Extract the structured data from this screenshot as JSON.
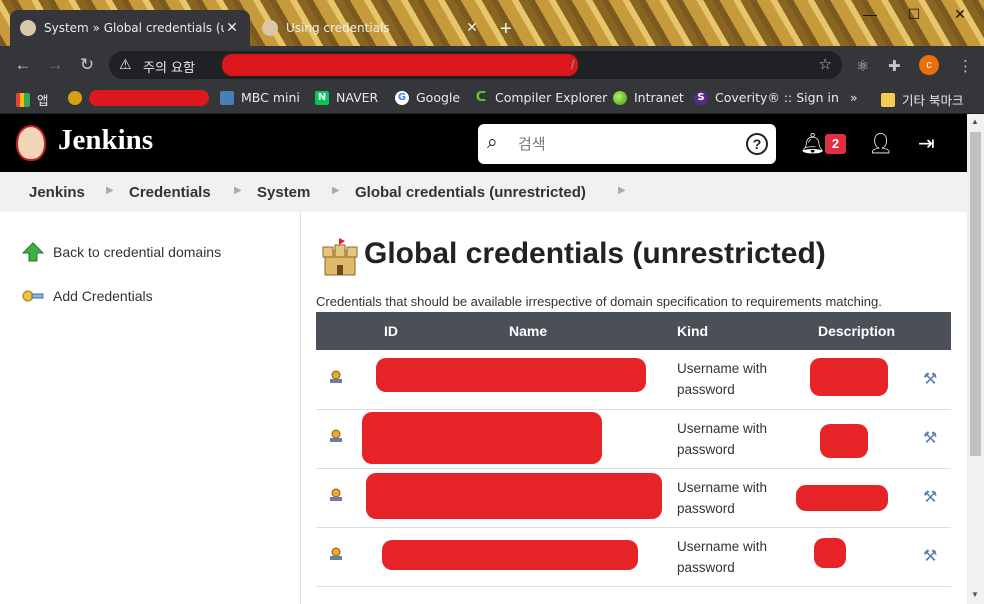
{
  "browser": {
    "tabs": [
      {
        "title": "System » Global credentials (un",
        "active": true
      },
      {
        "title": "Using credentials",
        "active": false
      }
    ],
    "new_tab": "+",
    "window_controls": {
      "minimize": "—",
      "maximize": "☐",
      "close": "✕"
    },
    "address_bar": {
      "security_label": "주의 요함",
      "url_visible": "/"
    },
    "profile_initial": "c",
    "bookmarks": [
      {
        "label": "앱"
      },
      {
        "label": "MBC mini"
      },
      {
        "label": "NAVER"
      },
      {
        "label": "Google"
      },
      {
        "label": "Compiler Explorer"
      },
      {
        "label": "Intranet"
      },
      {
        "label": "Coverity® :: Sign in"
      },
      {
        "label": "»"
      },
      {
        "label": "기타 북마크"
      }
    ]
  },
  "header": {
    "brand": "Jenkins",
    "search_placeholder": "검색",
    "help": "?",
    "notification_count": "2"
  },
  "breadcrumb": [
    "Jenkins",
    "Credentials",
    "System",
    "Global credentials (unrestricted)"
  ],
  "sidebar": {
    "items": [
      {
        "label": "Back to credential domains"
      },
      {
        "label": "Add Credentials"
      }
    ]
  },
  "main": {
    "title": "Global credentials (unrestricted)",
    "description": "Credentials that should be available irrespective of domain specification to requirements matching.",
    "table": {
      "columns": [
        "ID",
        "Name",
        "Kind",
        "Description"
      ],
      "rows": [
        {
          "kind_line1": "Username with",
          "kind_line2": "password"
        },
        {
          "kind_line1": "Username with",
          "kind_line2": "password"
        },
        {
          "kind_line1": "Username with",
          "kind_line2": "password"
        },
        {
          "kind_line1": "Username with",
          "kind_line2": "password"
        }
      ]
    }
  },
  "colors": {
    "header_bg": "#000000",
    "table_header_bg": "#4b5058",
    "badge": "#e0303f",
    "redaction": "#e5181c"
  }
}
